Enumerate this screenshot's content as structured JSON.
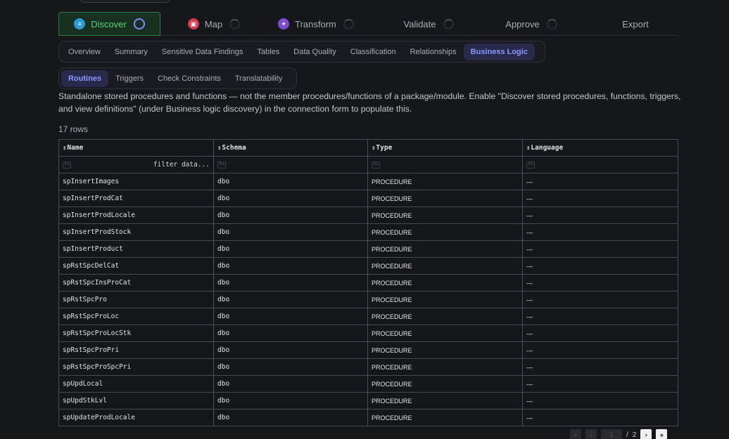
{
  "stepper": [
    {
      "label": "Discover",
      "icon": "database-icon",
      "icon_color": "#2a9bd6",
      "state": "active"
    },
    {
      "label": "Map",
      "icon": "map-icon",
      "icon_color": "#d2384e",
      "state": "pending"
    },
    {
      "label": "Transform",
      "icon": "transform-icon",
      "icon_color": "#7d4bd0",
      "state": "pending"
    },
    {
      "label": "Validate",
      "state": "pending"
    },
    {
      "label": "Approve",
      "state": "pending"
    },
    {
      "label": "Export",
      "state": "none"
    }
  ],
  "tabs": [
    "Overview",
    "Summary",
    "Sensitive Data Findings",
    "Tables",
    "Data Quality",
    "Classification",
    "Relationships",
    "Business Logic"
  ],
  "active_tab": "Business Logic",
  "subtabs": [
    "Routines",
    "Triggers",
    "Check Constraints",
    "Translatability"
  ],
  "active_subtab": "Routines",
  "description": "Standalone stored procedures and functions — not the member procedures/functions of a package/module. Enable \"Discover stored procedures, functions, triggers, and view definitions\" (under Business logic discovery) in the connection form to populate this.",
  "row_count": "17 rows",
  "table": {
    "sort_glyph": "⇕",
    "columns": [
      "Name",
      "Schema",
      "Type",
      "Language"
    ],
    "filter_placeholder": "filter data...",
    "rows": [
      [
        "spInsertImages",
        "dbo",
        "PROCEDURE",
        "—"
      ],
      [
        "spInsertProdCat",
        "dbo",
        "PROCEDURE",
        "—"
      ],
      [
        "spInsertProdLocale",
        "dbo",
        "PROCEDURE",
        "—"
      ],
      [
        "spInsertProdStock",
        "dbo",
        "PROCEDURE",
        "—"
      ],
      [
        "spInsertProduct",
        "dbo",
        "PROCEDURE",
        "—"
      ],
      [
        "spRstSpcDelCat",
        "dbo",
        "PROCEDURE",
        "—"
      ],
      [
        "spRstSpcInsProCat",
        "dbo",
        "PROCEDURE",
        "—"
      ],
      [
        "spRstSpcPro",
        "dbo",
        "PROCEDURE",
        "—"
      ],
      [
        "spRstSpcProLoc",
        "dbo",
        "PROCEDURE",
        "—"
      ],
      [
        "spRstSpcProLocStk",
        "dbo",
        "PROCEDURE",
        "—"
      ],
      [
        "spRstSpcProPri",
        "dbo",
        "PROCEDURE",
        "—"
      ],
      [
        "spRstSpcProSpcPri",
        "dbo",
        "PROCEDURE",
        "—"
      ],
      [
        "spUpdLocal",
        "dbo",
        "PROCEDURE",
        "—"
      ],
      [
        "spUpdStkLvl",
        "dbo",
        "PROCEDURE",
        "—"
      ],
      [
        "spUpdateProdLocale",
        "dbo",
        "PROCEDURE",
        "—"
      ]
    ]
  },
  "pagination": {
    "first": "«",
    "prev": "‹",
    "current_page": "1",
    "separator": "/",
    "total_pages": "2",
    "next": "›",
    "last": "»"
  }
}
